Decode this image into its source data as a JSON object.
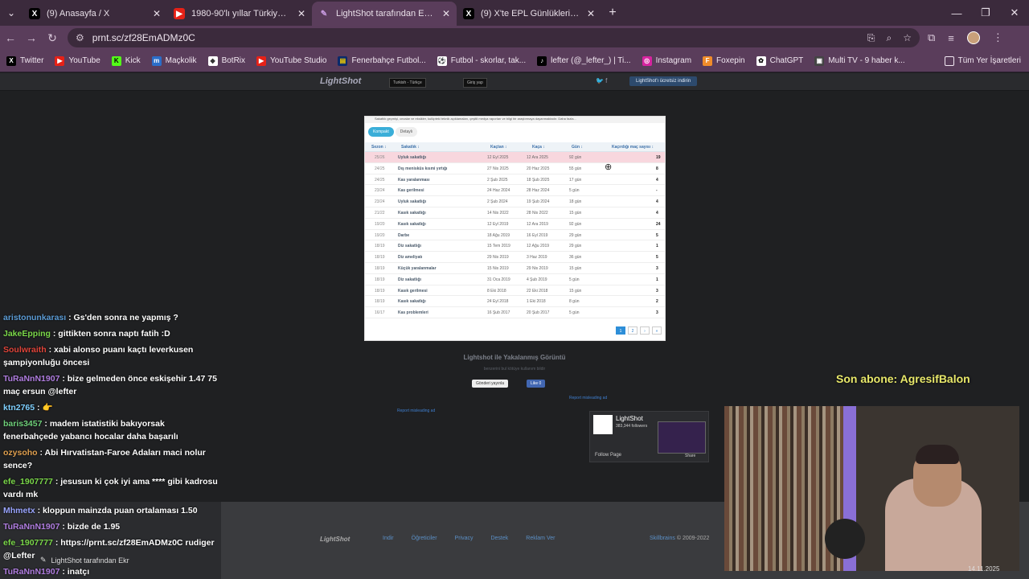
{
  "browser": {
    "tabs": [
      {
        "icon": "x-icon",
        "title": "(9) Anasayfa / X",
        "active": false
      },
      {
        "icon": "youtube-icon",
        "title": "1980-90'lı yıllar Türkiye'nin baş",
        "active": false
      },
      {
        "icon": "lightshot-icon",
        "title": "LightShot tarafından Ekran Gör",
        "active": true
      },
      {
        "icon": "x-icon",
        "title": "(9) X'te EPL Günlükleri: \"ıx Yusu",
        "active": false
      }
    ],
    "url": "prnt.sc/zf28EmADMz0C",
    "bookmarks": [
      {
        "icon": "x-icon",
        "label": "Twitter"
      },
      {
        "icon": "youtube-icon",
        "label": "YouTube"
      },
      {
        "icon": "kick-icon",
        "label": "Kick"
      },
      {
        "icon": "mackolik-icon",
        "label": "Maçkolik"
      },
      {
        "icon": "botrix-icon",
        "label": "BotRix"
      },
      {
        "icon": "youtube-icon",
        "label": "YouTube Studio"
      },
      {
        "icon": "fenerbahce-icon",
        "label": "Fenerbahçe Futbol..."
      },
      {
        "icon": "flashscore-icon",
        "label": "Futbol - skorlar, tak..."
      },
      {
        "icon": "tiktok-icon",
        "label": "lefter (@_lefter_) | Ti..."
      },
      {
        "icon": "instagram-icon",
        "label": "Instagram"
      },
      {
        "icon": "foxepin-icon",
        "label": "Foxepin"
      },
      {
        "icon": "chatgpt-icon",
        "label": "ChatGPT"
      },
      {
        "icon": "multitv-icon",
        "label": "Multi TV - 9 haber k..."
      }
    ],
    "all_bookmarks": "Tüm Yer İşaretleri"
  },
  "lightshot": {
    "logo": "LightShot",
    "language": "Turkish - Türkçe",
    "login": "Giriş yap",
    "download": "LightShot'ı ücretsiz indirin",
    "screenshot": {
      "notice": "Sakatlık geçmişi, cezalar ve eksikler, kulüpteki teknik açıklamaları, çeşitli medya raporları ve bilgi bir araştırmaya dayanmaktadır. Daha fazla...",
      "tab_compact": "Kompakt",
      "tab_detail": "Detaylı",
      "headers": [
        "Sezon ↕",
        "Sakatlık ↕",
        "Kaçtan ↕",
        "Kaça ↕",
        "Gün ↕",
        "Kaçırdığı maç sayısı ↕"
      ],
      "rows": [
        {
          "season": "25/26",
          "injury": "Uyluk sakatlığı",
          "from": "12 Eyl 2025",
          "until": "12 Ara 2025",
          "days": "92 gün",
          "games": "19",
          "hl": true
        },
        {
          "season": "24/25",
          "injury": "Dış menisküs kısmi yırtığı",
          "from": "27 Nis 2025",
          "until": "20 Haz 2025",
          "days": "55 gün",
          "games": "8"
        },
        {
          "season": "24/25",
          "injury": "Kas yaralanması",
          "from": "2 Şub 2025",
          "until": "18 Şub 2025",
          "days": "17 gün",
          "games": "4"
        },
        {
          "season": "23/24",
          "injury": "Kas gerilmesi",
          "from": "24 Haz 2024",
          "until": "28 Haz 2024",
          "days": "5 gün",
          "games": "-"
        },
        {
          "season": "23/24",
          "injury": "Uyluk sakatlığı",
          "from": "2 Şub 2024",
          "until": "19 Şub 2024",
          "days": "18 gün",
          "games": "4"
        },
        {
          "season": "21/22",
          "injury": "Kasık sakatlığı",
          "from": "14 Nis 2022",
          "until": "28 Nis 2022",
          "days": "15 gün",
          "games": "4"
        },
        {
          "season": "19/20",
          "injury": "Kasık sakatlığı",
          "from": "12 Eyl 2019",
          "until": "12 Ara 2019",
          "days": "92 gün",
          "games": "24"
        },
        {
          "season": "19/20",
          "injury": "Darbe",
          "from": "18 Ağu 2019",
          "until": "16 Eyl 2019",
          "days": "29 gün",
          "games": "5"
        },
        {
          "season": "18/19",
          "injury": "Diz sakatlığı",
          "from": "15 Tem 2019",
          "until": "12 Ağu 2019",
          "days": "29 gün",
          "games": "1"
        },
        {
          "season": "18/19",
          "injury": "Diz ameliyatı",
          "from": "29 Nis 2019",
          "until": "3 Haz 2019",
          "days": "36 gün",
          "games": "5"
        },
        {
          "season": "18/19",
          "injury": "Küçük yaralanmalar",
          "from": "15 Nis 2019",
          "until": "29 Nis 2019",
          "days": "15 gün",
          "games": "3"
        },
        {
          "season": "18/19",
          "injury": "Diz sakatlığı",
          "from": "31 Oca 2019",
          "until": "4 Şub 2019",
          "days": "5 gün",
          "games": "1"
        },
        {
          "season": "18/19",
          "injury": "Kasık gerilmesi",
          "from": "8 Eki 2018",
          "until": "22 Eki 2018",
          "days": "15 gün",
          "games": "3"
        },
        {
          "season": "18/19",
          "injury": "Kasık sakatlığı",
          "from": "24 Eyl 2018",
          "until": "1 Eki 2018",
          "days": "8 gün",
          "games": "2"
        },
        {
          "season": "16/17",
          "injury": "Kas problemleri",
          "from": "16 Şub 2017",
          "until": "20 Şub 2017",
          "days": "5 gün",
          "games": "3"
        }
      ],
      "pages": [
        "1",
        "2",
        "›",
        "»"
      ]
    },
    "caption": "Lightshot ile Yakalanmış Görüntü",
    "caption_sub": "benzerini bul   kötüye kullanım bildir",
    "tweet": "Gönderi yayınla",
    "like": "Like 0",
    "report1": "Report misleading ad",
    "report2": "Report misleading ad",
    "fb_name": "LightShot",
    "fb_followers": "383,344 followers",
    "fb_follow": "Follow Page",
    "fb_share": "Share",
    "footer_logo": "LightShot",
    "footer_links": [
      "Indir",
      "Öğreticiler",
      "Privacy",
      "Destek",
      "Reklam Ver"
    ],
    "footer_brand": "Skillbrains",
    "footer_copy": " © 2009-2022"
  },
  "chat": [
    {
      "user": "aristonunkarası",
      "color": "#5b9bd5",
      "text": "Gs'den sonra ne yapmış ?"
    },
    {
      "user": "JakeEpping",
      "color": "#7bd84a",
      "text": "gittikten sonra naptı fatih :D"
    },
    {
      "user": "Soulwraith",
      "color": "#e0443a",
      "text": "xabi alonso puanı kaçtı leverkusen şampiyonluğu öncesi"
    },
    {
      "user": "TuRaNnN1907",
      "color": "#b07de0",
      "text": "bize gelmeden önce eskişehir 1.47 75 maç ersun @lefter"
    },
    {
      "user": "ktn2765",
      "color": "#7fd0ff",
      "text": "👉"
    },
    {
      "user": "baris3457",
      "color": "#6fd07a",
      "text": "madem istatistiki bakıyorsak fenerbahçede yabancı hocalar daha başarılı"
    },
    {
      "user": "ozysoho",
      "color": "#e0a050",
      "text": "Abi Hırvatistan-Faroe Adaları maci nolur sence?"
    },
    {
      "user": "efe_1907777",
      "color": "#7bd84a",
      "text": "jesusun ki çok iyi ama **** gibi kadrosu vardı mk"
    },
    {
      "user": "Mhmetx",
      "color": "#9aa5ff",
      "text": "kloppun mainzda puan ortalaması 1.50"
    },
    {
      "user": "TuRaNnN1907",
      "color": "#b07de0",
      "text": "bizde de 1.95"
    },
    {
      "user": "efe_1907777",
      "color": "#7bd84a",
      "text": "https://prnt.sc/zf28EmADMz0C rudiger @Lefter"
    },
    {
      "user": "TuRaNnN1907",
      "color": "#b07de0",
      "text": "inatçı"
    }
  ],
  "overlay": {
    "last_sub": "Son abone: AgresifBalon",
    "taskbar_title": "LightShot tarafından Ekr",
    "date": "14.11.2025"
  }
}
